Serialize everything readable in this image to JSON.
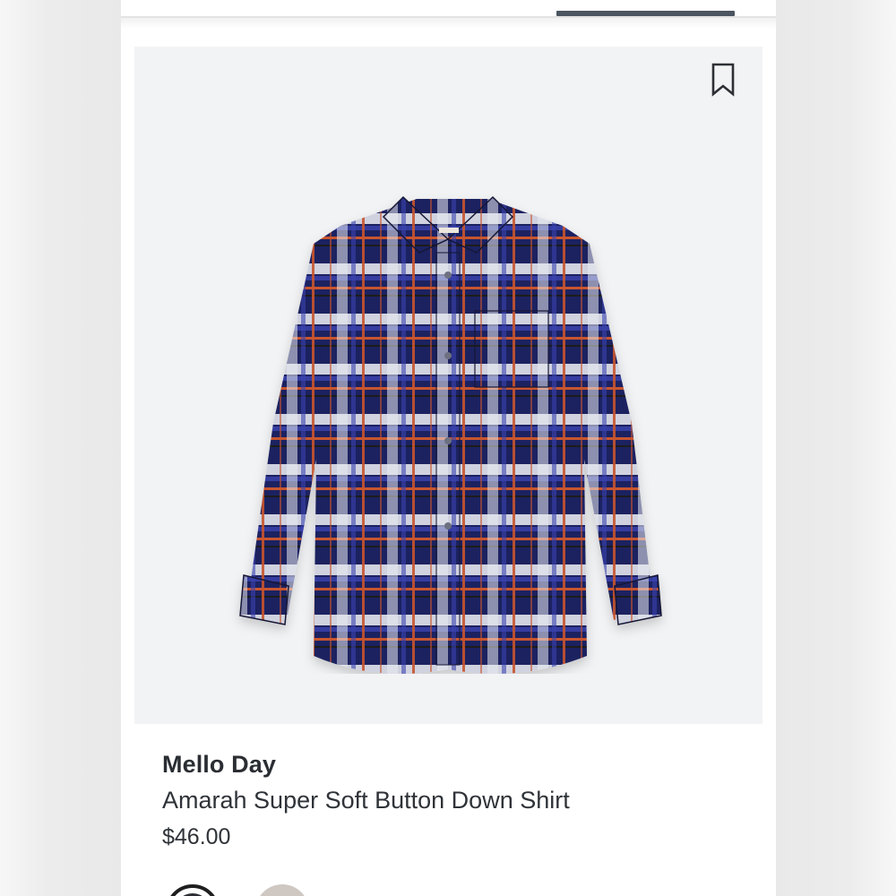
{
  "product": {
    "brand": "Mello Day",
    "name": "Amarah Super Soft Button Down Shirt",
    "price": "$46.00",
    "image_alt_icon": "plaid-shirt-image"
  },
  "icons": {
    "bookmark": "bookmark-icon"
  },
  "colors": {
    "card_background": "#f2f3f5",
    "tab_indicator": "#4a5560",
    "text": "#2f3338"
  },
  "swatches": [
    {
      "color": "#2b2d33",
      "selected": true
    },
    {
      "color": "#cfc8c2",
      "selected": false
    }
  ]
}
